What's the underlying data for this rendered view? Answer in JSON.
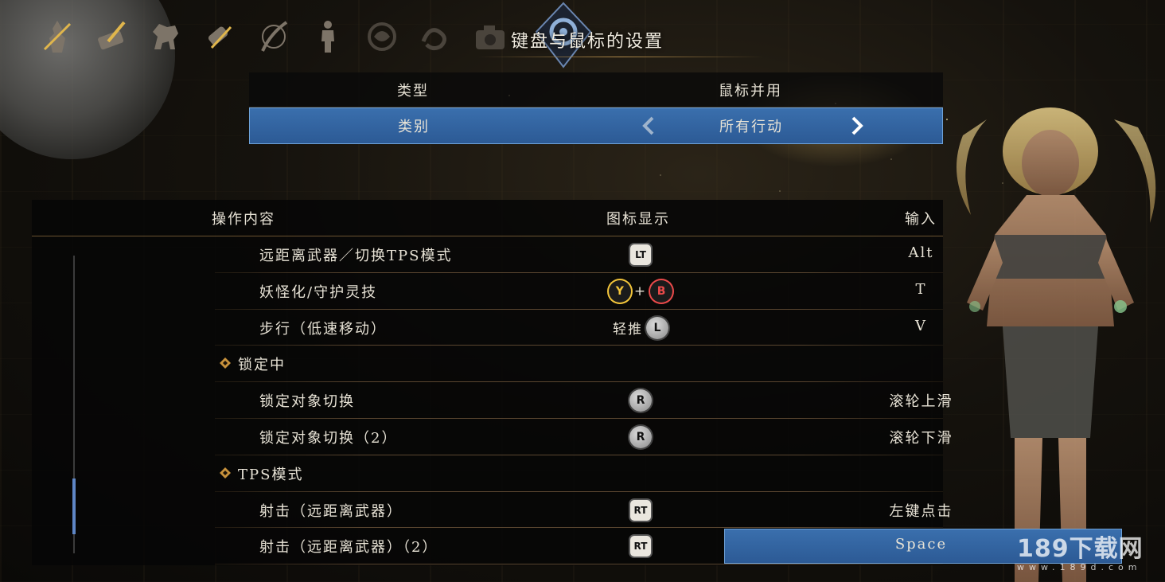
{
  "header": {
    "title": "键盘与鼠标的设置",
    "tab_icons": [
      "samurai-icon",
      "scroll-quill-icon",
      "horse-icon",
      "scrolls-icon",
      "katana-icon",
      "figure-icon",
      "dragon-crest-icon",
      "serpent-crest-icon",
      "camera-icon"
    ],
    "active_icon": "gear-icon"
  },
  "settings": [
    {
      "label": "类型",
      "value": "鼠标并用",
      "selected": false
    },
    {
      "label": "类别",
      "value": "所有行动",
      "selected": true
    }
  ],
  "table": {
    "headers": {
      "action": "操作内容",
      "icon": "图标显示",
      "input": "输入"
    },
    "rows": [
      {
        "type": "item",
        "label": "远距离武器／切换TPS模式",
        "icons": [
          {
            "kind": "square",
            "text": "LT"
          }
        ],
        "input": "Alt"
      },
      {
        "type": "item",
        "label": "妖怪化/守护灵技",
        "icons": [
          {
            "kind": "y",
            "text": "Y"
          },
          {
            "kind": "plus",
            "text": "+"
          },
          {
            "kind": "b",
            "text": "B"
          }
        ],
        "input": "T"
      },
      {
        "type": "item",
        "label": "步行（低速移动）",
        "icons": [
          {
            "kind": "text",
            "text": "轻推"
          },
          {
            "kind": "stick",
            "text": "L"
          }
        ],
        "input": "V"
      },
      {
        "type": "section",
        "label": "锁定中"
      },
      {
        "type": "item",
        "label": "锁定对象切换",
        "icons": [
          {
            "kind": "stick",
            "text": "R"
          }
        ],
        "input": "滚轮上滑"
      },
      {
        "type": "item",
        "label": "锁定对象切换（2）",
        "icons": [
          {
            "kind": "stick",
            "text": "R"
          }
        ],
        "input": "滚轮下滑"
      },
      {
        "type": "section",
        "label": "TPS模式"
      },
      {
        "type": "item",
        "label": "射击（远距离武器）",
        "icons": [
          {
            "kind": "square",
            "text": "RT"
          }
        ],
        "input": "左键点击"
      },
      {
        "type": "item",
        "label": "射击（远距离武器）（2）",
        "icons": [
          {
            "kind": "square",
            "text": "RT"
          }
        ],
        "input": "Space",
        "selected": true
      }
    ]
  },
  "colors": {
    "selected_bg": "#3a6fad",
    "accent_gold": "#c8923c",
    "y_button": "#f2c43a",
    "b_button": "#ea4a4a"
  },
  "watermark": {
    "main": "189下载网",
    "sub": "www.189d.com"
  }
}
